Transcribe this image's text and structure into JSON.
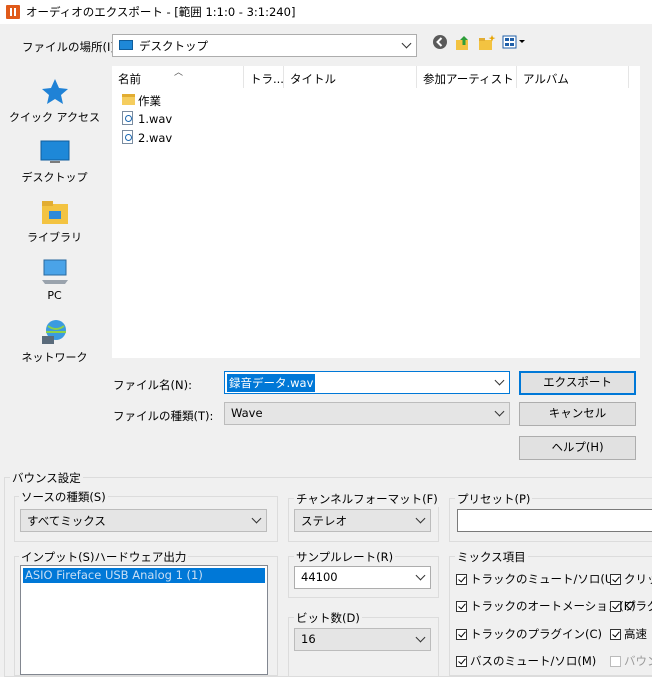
{
  "window": {
    "title": "オーディオのエクスポート - [範囲 1:1:0 - 3:1:240]"
  },
  "location": {
    "label": "ファイルの場所(I):",
    "value": "デスクトップ"
  },
  "toolbar": {
    "back_icon": "back-icon",
    "up_icon": "up-folder-icon",
    "new_folder_icon": "new-folder-icon",
    "view_icon": "view-menu-icon"
  },
  "places": [
    {
      "label": "クイック アクセス",
      "icon": "star-icon"
    },
    {
      "label": "デスクトップ",
      "icon": "desktop-icon"
    },
    {
      "label": "ライブラリ",
      "icon": "library-icon"
    },
    {
      "label": "PC",
      "icon": "pc-icon"
    },
    {
      "label": "ネットワーク",
      "icon": "network-icon"
    }
  ],
  "columns": [
    "名前",
    "トラ...",
    "タイトル",
    "参加アーティスト",
    "アルバム"
  ],
  "files": [
    {
      "name": "作業",
      "type": "folder"
    },
    {
      "name": "1.wav",
      "type": "wav"
    },
    {
      "name": "2.wav",
      "type": "wav"
    }
  ],
  "filename": {
    "label": "ファイル名(N):",
    "value": "録音データ.wav"
  },
  "filetype": {
    "label": "ファイルの種類(T):",
    "value": "Wave"
  },
  "buttons": {
    "export": "エクスポート",
    "cancel": "キャンセル",
    "help": "ヘルプ(H)"
  },
  "bounce": {
    "title": "バウンス設定",
    "source_type": {
      "label": "ソースの種類(S)",
      "value": "すべてミックス"
    },
    "channel_format": {
      "label": "チャンネルフォーマット(F)",
      "value": "ステレオ"
    },
    "preset": {
      "label": "プリセット(P)",
      "value": ""
    },
    "input": {
      "label": "インプット(S)ハードウェア出力",
      "selected": "ASIO Fireface USB Analog 1 (1)"
    },
    "sample_rate": {
      "label": "サンプルレート(R)",
      "value": "44100"
    },
    "bit_depth": {
      "label": "ビット数(D)",
      "value": "16"
    },
    "mix_items": {
      "label": "ミックス項目",
      "left": [
        {
          "label": "トラックのミュート/ソロ(U)",
          "checked": true
        },
        {
          "label": "トラックのオートメーション(K)",
          "checked": true
        },
        {
          "label": "トラックのプラグイン(C)",
          "checked": true
        },
        {
          "label": "バスのミュート/ソロ(M)",
          "checked": true
        }
      ],
      "right": [
        {
          "label": "クリップ",
          "checked": true
        },
        {
          "label": "プラグ",
          "checked": true
        },
        {
          "label": "高速",
          "checked": true
        },
        {
          "label": "バウン",
          "checked": false
        }
      ]
    }
  }
}
